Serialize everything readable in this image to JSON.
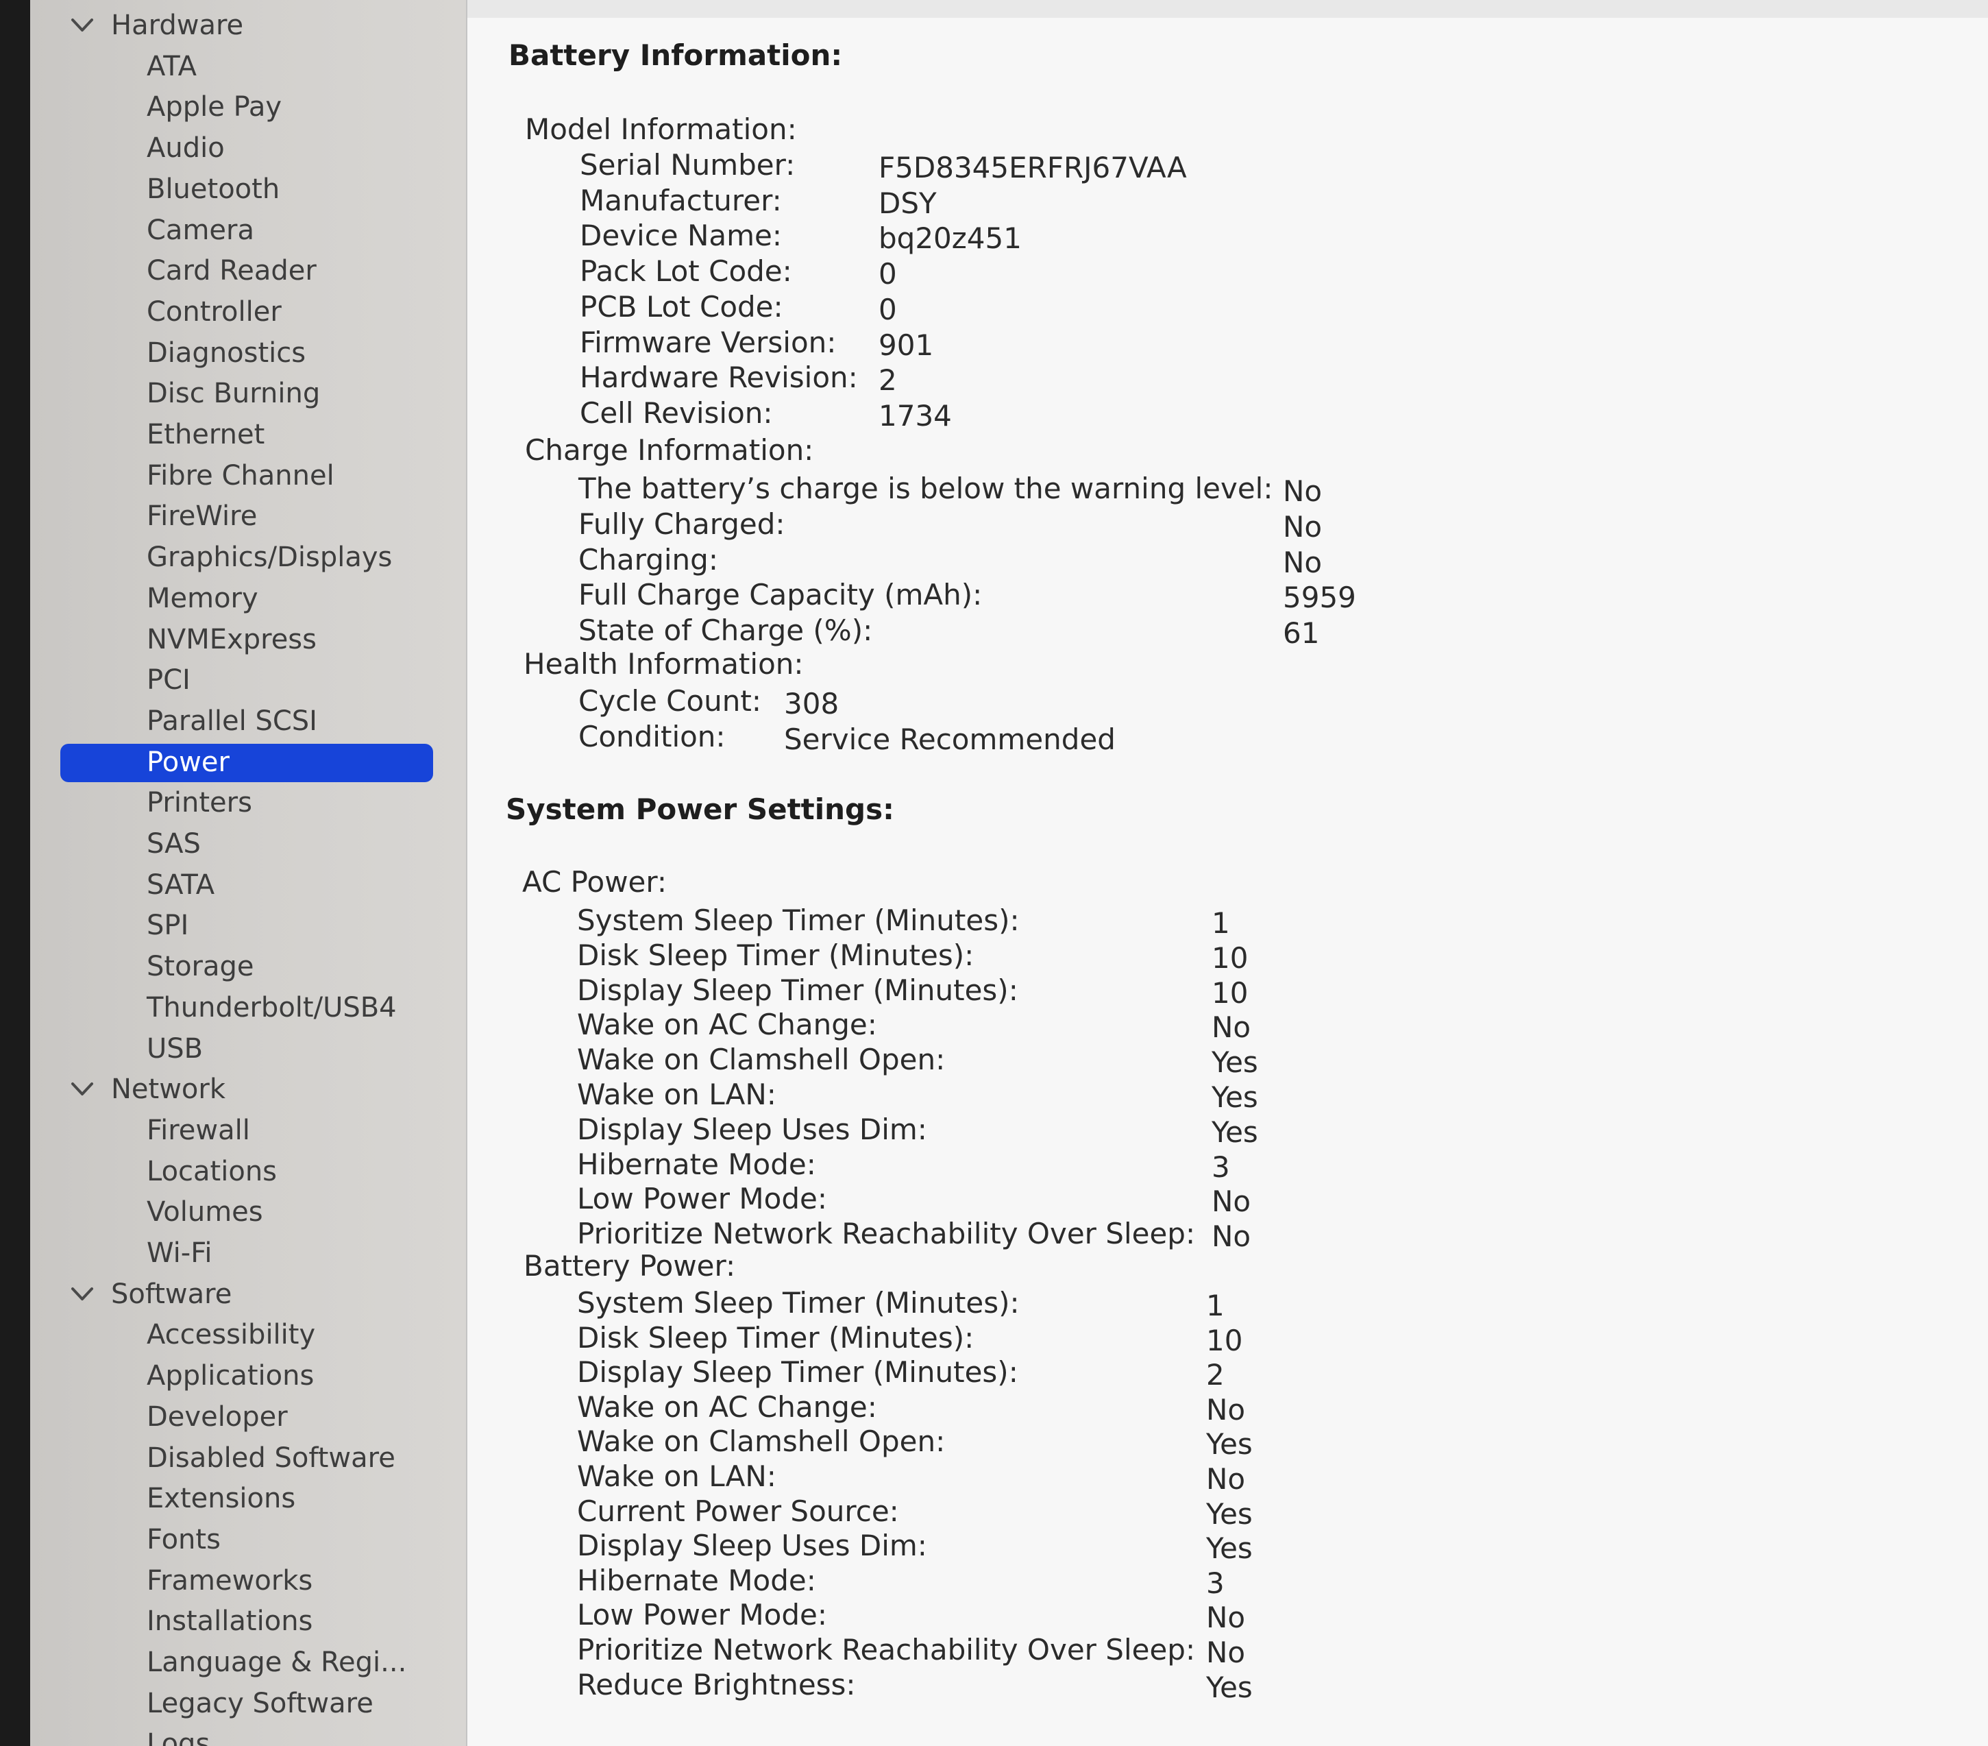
{
  "sidebar": {
    "groups": [
      {
        "label": "Hardware",
        "items": [
          "ATA",
          "Apple Pay",
          "Audio",
          "Bluetooth",
          "Camera",
          "Card Reader",
          "Controller",
          "Diagnostics",
          "Disc Burning",
          "Ethernet",
          "Fibre Channel",
          "FireWire",
          "Graphics/Displays",
          "Memory",
          "NVMExpress",
          "PCI",
          "Parallel SCSI",
          "Power",
          "Printers",
          "SAS",
          "SATA",
          "SPI",
          "Storage",
          "Thunderbolt/USB4",
          "USB"
        ]
      },
      {
        "label": "Network",
        "items": [
          "Firewall",
          "Locations",
          "Volumes",
          "Wi-Fi"
        ]
      },
      {
        "label": "Software",
        "items": [
          "Accessibility",
          "Applications",
          "Developer",
          "Disabled Software",
          "Extensions",
          "Fonts",
          "Frameworks",
          "Installations",
          "Language & Regi...",
          "Legacy Software",
          "Logs"
        ]
      }
    ],
    "selected": "Power"
  },
  "battery": {
    "title": "Battery Information:",
    "model": {
      "header": "Model Information:",
      "rows": [
        {
          "label": "Serial Number:",
          "value": "F5D8345ERFRJ67VAA"
        },
        {
          "label": "Manufacturer:",
          "value": "DSY"
        },
        {
          "label": "Device Name:",
          "value": "bq20z451"
        },
        {
          "label": "Pack Lot Code:",
          "value": "0"
        },
        {
          "label": "PCB Lot Code:",
          "value": "0"
        },
        {
          "label": "Firmware Version:",
          "value": "901"
        },
        {
          "label": "Hardware Revision:",
          "value": "2"
        },
        {
          "label": "Cell Revision:",
          "value": "1734"
        }
      ]
    },
    "charge": {
      "header": "Charge Information:",
      "rows": [
        {
          "label": "The battery’s charge is below the warning level:",
          "value": "No"
        },
        {
          "label": "Fully Charged:",
          "value": "No"
        },
        {
          "label": "Charging:",
          "value": "No"
        },
        {
          "label": "Full Charge Capacity (mAh):",
          "value": "5959"
        },
        {
          "label": "State of Charge (%):",
          "value": "61"
        }
      ]
    },
    "health": {
      "header": "Health Information:",
      "rows": [
        {
          "label": "Cycle Count:",
          "value": "308"
        },
        {
          "label": "Condition:",
          "value": "Service Recommended"
        }
      ]
    }
  },
  "power": {
    "title": "System Power Settings:",
    "ac": {
      "header": "AC Power:",
      "rows": [
        {
          "label": "System Sleep Timer (Minutes):",
          "value": "1"
        },
        {
          "label": "Disk Sleep Timer (Minutes):",
          "value": "10"
        },
        {
          "label": "Display Sleep Timer (Minutes):",
          "value": "10"
        },
        {
          "label": "Wake on AC Change:",
          "value": "No"
        },
        {
          "label": "Wake on Clamshell Open:",
          "value": "Yes"
        },
        {
          "label": "Wake on LAN:",
          "value": "Yes"
        },
        {
          "label": "Display Sleep Uses Dim:",
          "value": "Yes"
        },
        {
          "label": "Hibernate Mode:",
          "value": "3"
        },
        {
          "label": "Low Power Mode:",
          "value": "No"
        },
        {
          "label": "Prioritize Network Reachability Over Sleep:",
          "value": "No"
        }
      ]
    },
    "battery": {
      "header": "Battery Power:",
      "rows": [
        {
          "label": "System Sleep Timer (Minutes):",
          "value": "1"
        },
        {
          "label": "Disk Sleep Timer (Minutes):",
          "value": "10"
        },
        {
          "label": "Display Sleep Timer (Minutes):",
          "value": "2"
        },
        {
          "label": "Wake on AC Change:",
          "value": "No"
        },
        {
          "label": "Wake on Clamshell Open:",
          "value": "Yes"
        },
        {
          "label": "Wake on LAN:",
          "value": "No"
        },
        {
          "label": "Current Power Source:",
          "value": "Yes"
        },
        {
          "label": "Display Sleep Uses Dim:",
          "value": "Yes"
        },
        {
          "label": "Hibernate Mode:",
          "value": "3"
        },
        {
          "label": "Low Power Mode:",
          "value": "No"
        },
        {
          "label": "Prioritize Network Reachability Over Sleep:",
          "value": "No"
        },
        {
          "label": "Reduce Brightness:",
          "value": "Yes"
        }
      ]
    }
  }
}
